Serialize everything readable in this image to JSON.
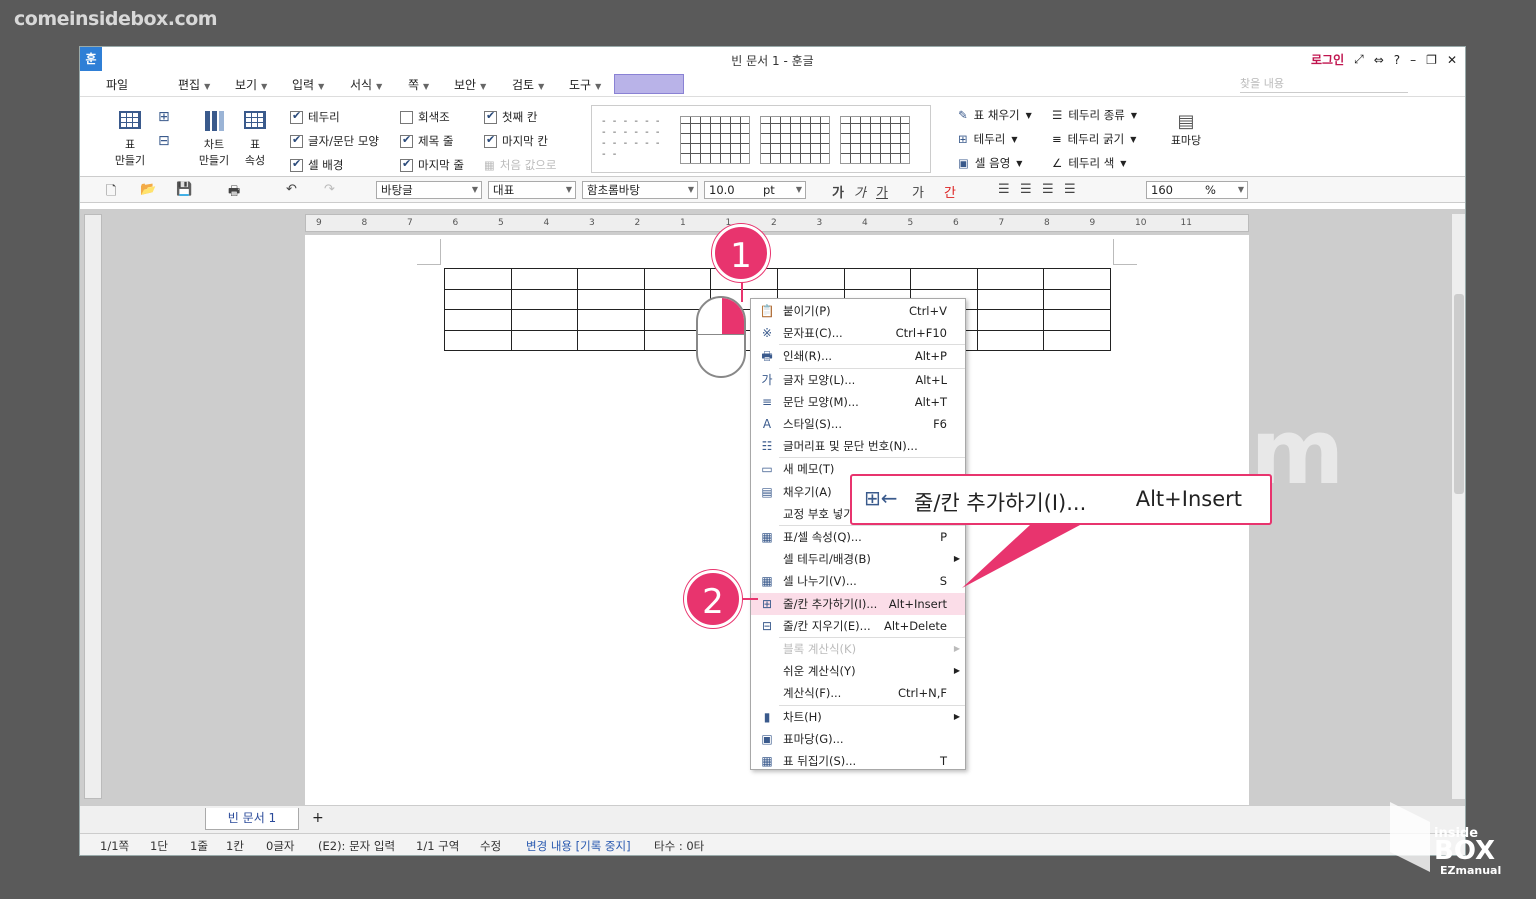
{
  "watermark": {
    "site": "comeinsidebox.com",
    "box_top": "inside",
    "box_main": "BOX",
    "box_bottom": "EZmanual"
  },
  "app": {
    "logo": "훈",
    "title": "빈 문서 1 - 훈글",
    "login": "로그인",
    "search_placeholder": "찾을 내용"
  },
  "menu": [
    "파일",
    "편집",
    "보기",
    "입력",
    "서식",
    "쪽",
    "보안",
    "검토",
    "도구"
  ],
  "ribbon": {
    "table_make": "표\n만들기",
    "chart_make": "차트\n만들기",
    "table_props": "표\n속성",
    "checks": [
      {
        "label": "테두리",
        "checked": true
      },
      {
        "label": "글자/문단 모양",
        "checked": true
      },
      {
        "label": "셀 배경",
        "checked": true
      },
      {
        "label": "회색조",
        "checked": false
      },
      {
        "label": "제목 줄",
        "checked": true
      },
      {
        "label": "마지막 줄",
        "checked": true
      },
      {
        "label": "첫째 칸",
        "checked": true
      },
      {
        "label": "마지막 칸",
        "checked": true
      },
      {
        "label": "처음 값으로",
        "checked": false
      }
    ],
    "right": [
      "표 채우기",
      "테두리",
      "셀 음영",
      "테두리 종류",
      "테두리 굵기",
      "테두리 색"
    ],
    "table_mark": "표마당"
  },
  "toolbar": {
    "style": "바탕글",
    "para": "대표",
    "font": "함초롬바탕",
    "size": "10.0",
    "unit": "pt",
    "zoom": "160",
    "zoom_unit": "%"
  },
  "ruler": [
    "9",
    "8",
    "7",
    "6",
    "5",
    "4",
    "3",
    "2",
    "1",
    "1",
    "2",
    "3",
    "4",
    "5",
    "6",
    "7",
    "8",
    "9",
    "10",
    "11"
  ],
  "context_menu": [
    {
      "icon": "paste-icon",
      "glyph": "📋",
      "label": "붙이기(P)",
      "key": "Ctrl+V"
    },
    {
      "icon": "symbol-icon",
      "glyph": "※",
      "label": "문자표(C)...",
      "key": "Ctrl+F10"
    },
    {
      "icon": "print-icon",
      "glyph": "🖶",
      "label": "인쇄(R)...",
      "key": "Alt+P"
    },
    {
      "icon": "char-shape-icon",
      "glyph": "가",
      "label": "글자 모양(L)...",
      "key": "Alt+L"
    },
    {
      "icon": "para-shape-icon",
      "glyph": "≡",
      "label": "문단 모양(M)...",
      "key": "Alt+T"
    },
    {
      "icon": "style-icon",
      "glyph": "A",
      "label": "스타일(S)...",
      "key": "F6"
    },
    {
      "icon": "bullet-icon",
      "glyph": "☷",
      "label": "글머리표 및 문단 번호(N)...",
      "key": ""
    },
    {
      "icon": "memo-icon",
      "glyph": "▭",
      "label": "새 메모(T)",
      "key": ""
    },
    {
      "icon": "fill-icon",
      "glyph": "▤",
      "label": "채우기(A)",
      "key": ""
    },
    {
      "icon": "",
      "glyph": "",
      "label": "교정 부호 넣기",
      "key": ""
    },
    {
      "icon": "table-props-icon",
      "glyph": "▦",
      "label": "표/셀 속성(Q)...",
      "key": "P"
    },
    {
      "icon": "",
      "glyph": "",
      "label": "셀 테두리/배경(B)",
      "key": "",
      "sub": true
    },
    {
      "icon": "split-cell-icon",
      "glyph": "▦",
      "label": "셀 나누기(V)...",
      "key": "S"
    },
    {
      "icon": "add-row-col-icon",
      "glyph": "⊞",
      "label": "줄/칸 추가하기(I)...",
      "key": "Alt+Insert",
      "hl": true
    },
    {
      "icon": "delete-row-col-icon",
      "glyph": "⊟",
      "label": "줄/칸 지우기(E)...",
      "key": "Alt+Delete"
    },
    {
      "icon": "",
      "glyph": "",
      "label": "블록 계산식(K)",
      "key": "",
      "sub": true,
      "dis": true
    },
    {
      "icon": "",
      "glyph": "",
      "label": "쉬운 계산식(Y)",
      "key": "",
      "sub": true
    },
    {
      "icon": "",
      "glyph": "",
      "label": "계산식(F)...",
      "key": "Ctrl+N,F"
    },
    {
      "icon": "chart-icon",
      "glyph": "▮",
      "label": "차트(H)",
      "key": "",
      "sub": true
    },
    {
      "icon": "table-mark-icon",
      "glyph": "▣",
      "label": "표마당(G)...",
      "key": ""
    },
    {
      "icon": "flip-table-icon",
      "glyph": "▦",
      "label": "표 뒤집기(S)...",
      "key": "T"
    }
  ],
  "callout": {
    "label": "줄/칸 추가하기(I)...",
    "key": "Alt+Insert"
  },
  "badges": {
    "one": "1",
    "two": "2"
  },
  "doc_tab": "빈 문서 1",
  "status": [
    "1/1쪽",
    "1단",
    "1줄",
    "1칸",
    "0글자",
    "(E2): 문자 입력",
    "1/1 구역",
    "수정",
    "변경 내용 [기록 중지]",
    "타수 : 0타"
  ]
}
